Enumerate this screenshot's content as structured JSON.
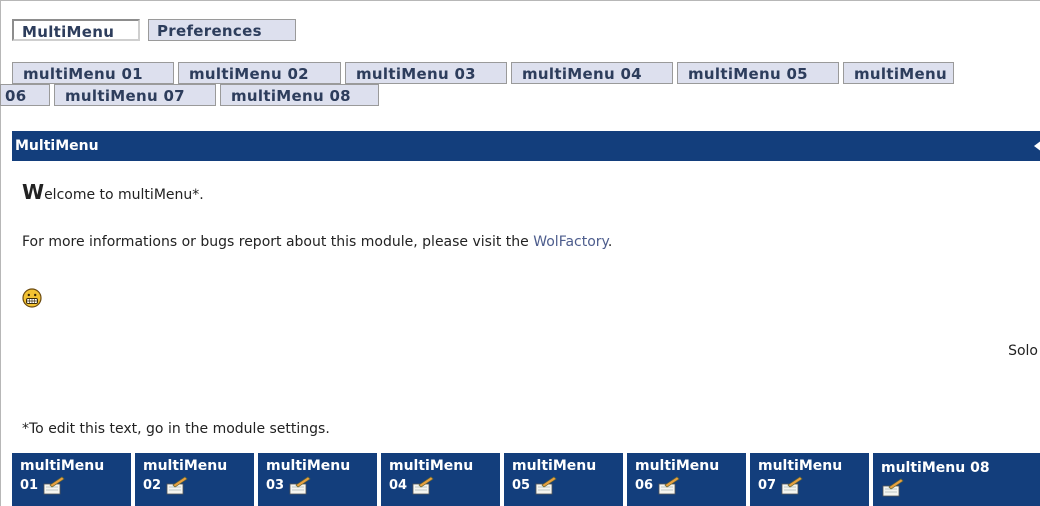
{
  "top_tabs": {
    "active": "MultiMenu",
    "inactive": "Preferences"
  },
  "menu_buttons": [
    "multiMenu 01",
    "multiMenu 02",
    "multiMenu 03",
    "multiMenu 04",
    "multiMenu 05",
    "multiMenu",
    "06",
    "multiMenu 07",
    "multiMenu 08"
  ],
  "panel": {
    "title": "MultiMenu",
    "welcome_first": "W",
    "welcome_rest": "elcome to multiMenu*.",
    "info_prefix": "For more informations or bugs report about this module, please visit the ",
    "info_link": "WolFactory",
    "info_suffix": ".",
    "signature": "Solo",
    "note": "*To edit this text, go in the module settings."
  },
  "bottom_menu": [
    {
      "label": "multiMenu",
      "num": "01"
    },
    {
      "label": "multiMenu",
      "num": "02"
    },
    {
      "label": "multiMenu",
      "num": "03"
    },
    {
      "label": "multiMenu",
      "num": "04"
    },
    {
      "label": "multiMenu",
      "num": "05"
    },
    {
      "label": "multiMenu",
      "num": "06"
    },
    {
      "label": "multiMenu",
      "num": "07"
    },
    {
      "label": "multiMenu 08",
      "num": ""
    }
  ],
  "colors": {
    "panel_bg": "#133e7c",
    "tab_bg": "#dde0ee",
    "link": "#4d5d8d"
  },
  "icons": {
    "bottom_item_icon": "pencil-notepad-icon",
    "smiley": "grin-smiley-icon",
    "collapse": "collapse-arrow-icon"
  }
}
